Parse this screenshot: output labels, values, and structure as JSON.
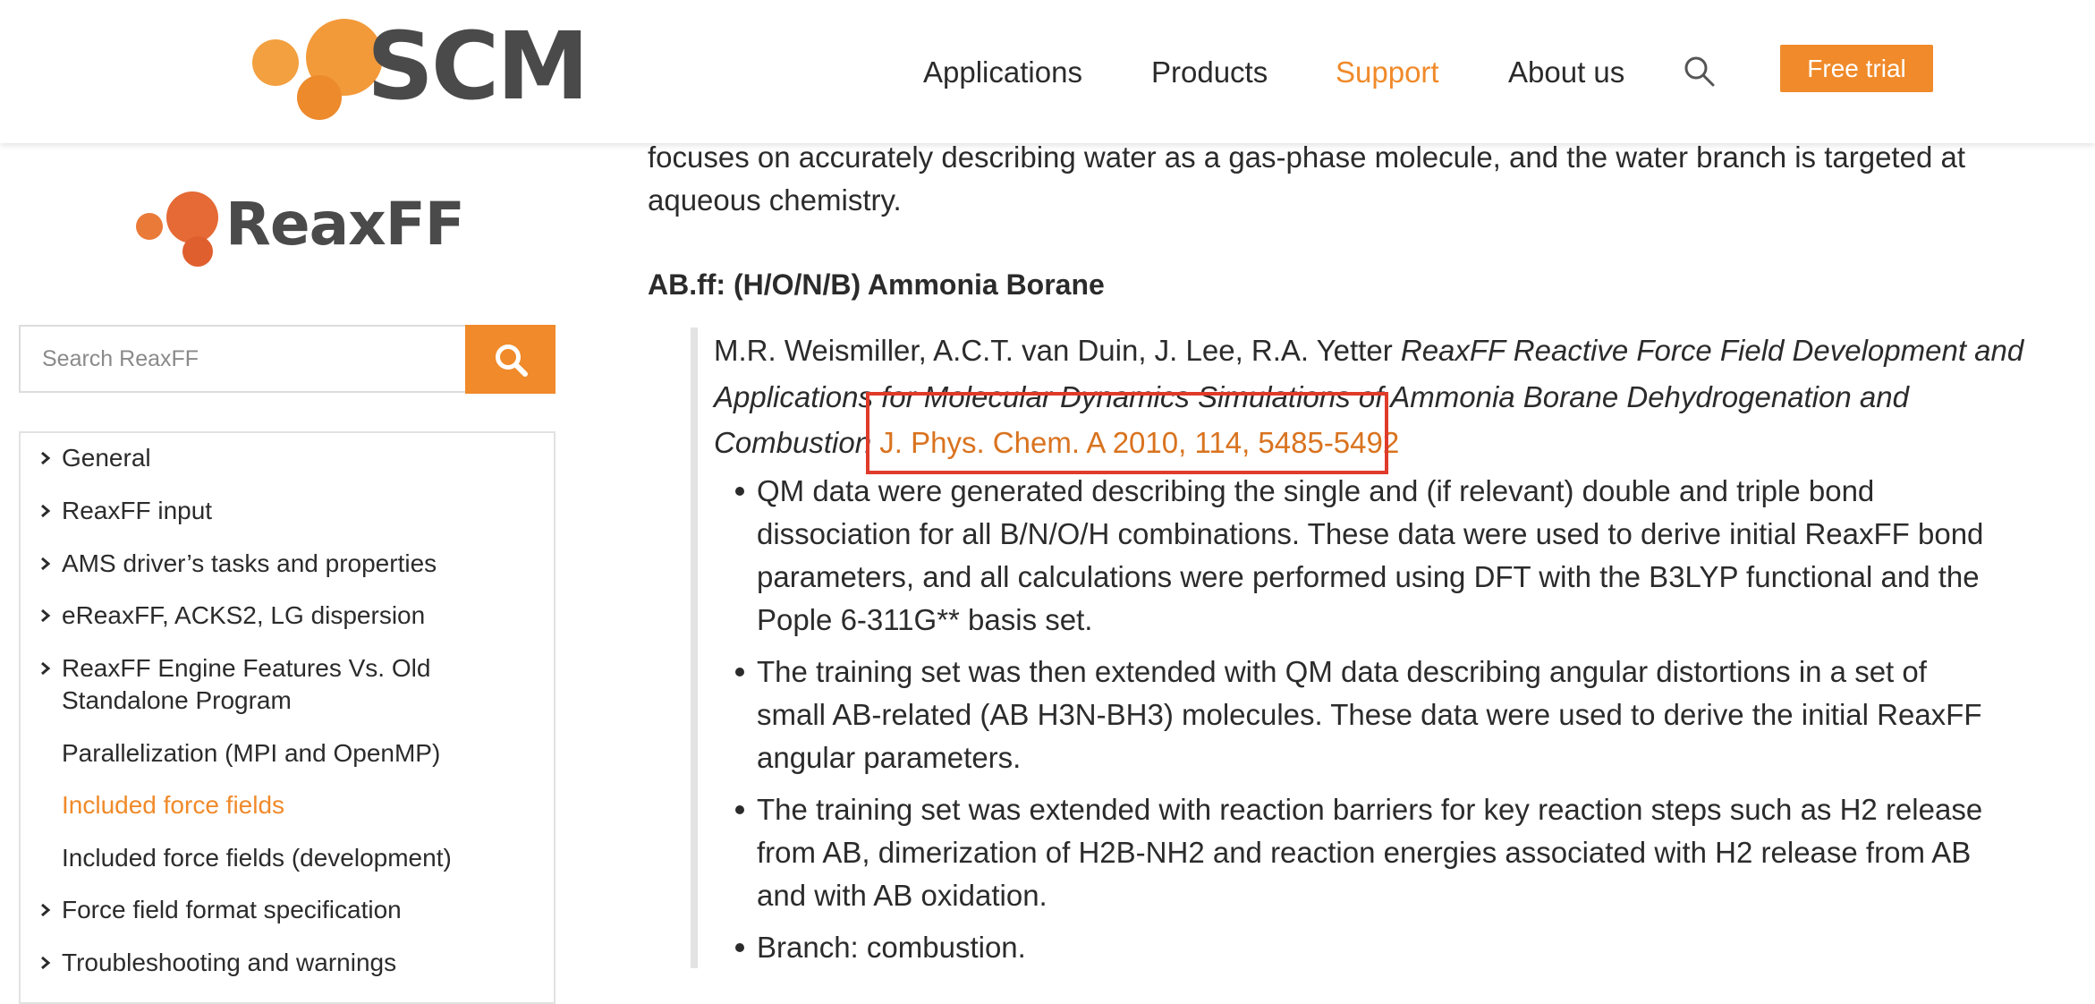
{
  "header": {
    "logo_text": "SCM",
    "nav": [
      "Applications",
      "Products",
      "Support",
      "About us"
    ],
    "active_nav": "Support",
    "free_trial_label": "Free trial"
  },
  "sidebar": {
    "logo_text": "ReaxFF",
    "search": {
      "placeholder": "Search ReaxFF"
    },
    "items": [
      {
        "label": "General",
        "expandable": true
      },
      {
        "label": "ReaxFF input",
        "expandable": true
      },
      {
        "label": "AMS driver’s tasks and properties",
        "expandable": true
      },
      {
        "label": "eReaxFF, ACKS2, LG dispersion",
        "expandable": true
      },
      {
        "label": "ReaxFF Engine Features Vs. Old",
        "label2": "Standalone Program",
        "expandable": true
      },
      {
        "label": "Parallelization (MPI and OpenMP)",
        "expandable": false
      },
      {
        "label": "Included force fields",
        "expandable": false,
        "active": true
      },
      {
        "label": "Included force fields (development)",
        "expandable": false
      },
      {
        "label": "Force field format specification",
        "expandable": true
      },
      {
        "label": "Troubleshooting and warnings",
        "expandable": true
      }
    ]
  },
  "main": {
    "intro_lines": [
      "focuses on accurately describing water as a gas-phase molecule, and the water branch is targeted at",
      "aqueous chemistry."
    ],
    "section_title": "AB.ff: (H/O/N/B) Ammonia Borane",
    "citation": {
      "authors": "M.R. Weismiller, A.C.T. van Duin, J. Lee, R.A. Yetter ",
      "title_line1": "ReaxFF Reactive Force Field Development and",
      "title_line2": "Applications for Molecular Dynamics Simulations of Ammonia Borane Dehydrogenation and",
      "title_line3": "Combustion",
      "link": "J. Phys. Chem. A 2010, 114, 5485-5492"
    },
    "bullets": [
      [
        "QM data were generated describing the single and (if relevant) double and triple bond",
        "dissociation for all B/N/O/H combinations. These data were used to derive initial ReaxFF bond",
        "parameters, and all calculations were performed using DFT with the B3LYP functional and the",
        "Pople 6-311G** basis set."
      ],
      [
        "The training set was then extended with QM data describing angular distortions in a set of",
        "small AB-related (AB H3N-BH3) molecules. These data were used to derive the initial ReaxFF",
        "angular parameters."
      ],
      [
        "The training set was extended with reaction barriers for key reaction steps such as H2 release",
        "from AB, dimerization of H2B-NH2 and reaction energies associated with H2 release from AB",
        "and with AB oxidation."
      ],
      [
        "Branch: combustion."
      ]
    ]
  },
  "colors": {
    "accent": "#f08a2a",
    "link": "#d9731f",
    "highlight": "#e03b2a"
  }
}
